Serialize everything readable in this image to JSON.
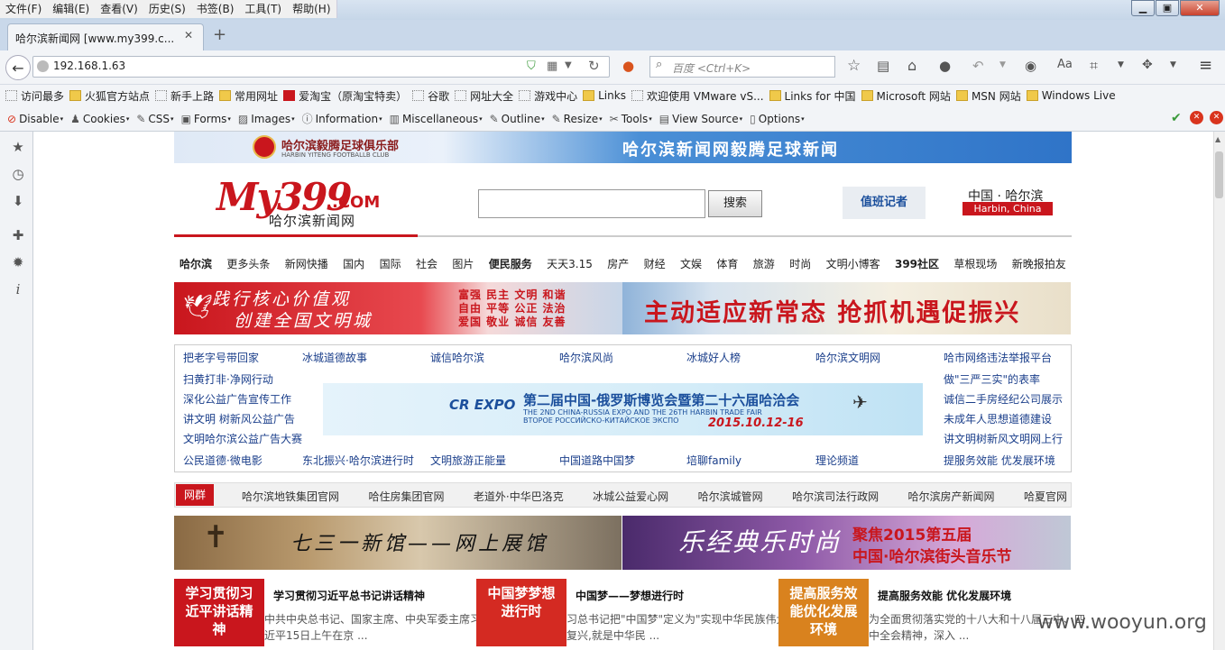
{
  "browser": {
    "menu": [
      "文件(F)",
      "编辑(E)",
      "查看(V)",
      "历史(S)",
      "书签(B)",
      "工具(T)",
      "帮助(H)"
    ],
    "tab_title": "哈尔滨新闻网 [www.my399.c...",
    "url": "192.168.1.63",
    "search_placeholder": "百度 <Ctrl+K>",
    "bookmarks": [
      "访问最多",
      "火狐官方站点",
      "新手上路",
      "常用网址",
      "爱淘宝（原淘宝特卖）",
      "谷歌",
      "网址大全",
      "游戏中心",
      "Links",
      "欢迎使用 VMware vS...",
      "Links for 中国",
      "Microsoft 网站",
      "MSN 网站",
      "Windows Live"
    ],
    "devbar": [
      "Disable",
      "Cookies",
      "CSS",
      "Forms",
      "Images",
      "Information",
      "Miscellaneous",
      "Outline",
      "Resize",
      "Tools",
      "View Source",
      "Options"
    ]
  },
  "page": {
    "banner_left": "哈尔滨毅腾足球俱乐部",
    "banner_left_en": "HARBIN YITENG FOOTBALLB CLUB",
    "banner_right": "哈尔滨新闻网毅腾足球新闻",
    "logo": "My399",
    "logo_com": ".COM",
    "logo_sub": "哈尔滨新闻网",
    "search_button": "搜索",
    "reporter": "值班记者",
    "location_cn": "中国 · 哈尔滨",
    "location_en": "Harbin, China",
    "nav": [
      {
        "t": "哈尔滨",
        "b": true
      },
      {
        "t": "更多头条",
        "b": false
      },
      {
        "t": "新网快播",
        "b": false
      },
      {
        "t": "国内",
        "b": false
      },
      {
        "t": "国际",
        "b": false
      },
      {
        "t": "社会",
        "b": false
      },
      {
        "t": "图片",
        "b": false
      },
      {
        "t": "便民服务",
        "b": true
      },
      {
        "t": "天天3.15",
        "b": false
      },
      {
        "t": "房产",
        "b": false
      },
      {
        "t": "财经",
        "b": false
      },
      {
        "t": "文娱",
        "b": false
      },
      {
        "t": "体育",
        "b": false
      },
      {
        "t": "旅游",
        "b": false
      },
      {
        "t": "时尚",
        "b": false
      },
      {
        "t": "文明小博客",
        "b": false
      },
      {
        "t": "399社区",
        "b": true
      },
      {
        "t": "草根现场",
        "b": false
      },
      {
        "t": "新晚报拍友",
        "b": false
      }
    ],
    "promo_left_1": "践行核心价值观",
    "promo_left_2": "创建全国文明城",
    "values": [
      "富强 民主 文明 和谐",
      "自由 平等 公正 法治",
      "爱国 敬业 诚信 友善"
    ],
    "promo_right": "主动适应新常态 抢抓机遇促振兴",
    "links": {
      "row1": [
        "把老字号带回家",
        "冰城道德故事",
        "诚信哈尔滨",
        "哈尔滨风尚",
        "冰城好人榜",
        "哈尔滨文明网",
        "哈市网络违法举报平台"
      ],
      "left": [
        "扫黄打非·净网行动",
        "深化公益广告宣传工作",
        "讲文明 树新风公益广告",
        "文明哈尔滨公益广告大赛"
      ],
      "right": [
        "做\"三严三实\"的表率",
        "诚信二手房经纪公司展示",
        "未成年人思想道德建设",
        "讲文明树新风文明网上行"
      ],
      "bottom": [
        "公民道德·微电影",
        "东北振兴·哈尔滨进行时",
        "文明旅游正能量",
        "中国道路中国梦",
        "培聊family",
        "理论频道",
        "提服务效能 优发展环境"
      ]
    },
    "expo_title": "第二届中国-俄罗斯博览会暨第二十六届哈洽会",
    "expo_en": "THE 2ND CHINA-RUSSIA EXPO AND THE 26TH HARBIN TRADE FAIR",
    "expo_ru": "ВТОРОЕ РОССИЙСКО-КИТАЙСКОЕ ЭКСПО",
    "expo_date": "2015.10.12-16",
    "expo_logo": "CR EXPO",
    "group_tag": "网群",
    "group_links": [
      "哈尔滨地铁集团官网",
      "哈住房集团官网",
      "老道外·中华巴洛克",
      "冰城公益爱心网",
      "哈尔滨城管网",
      "哈尔滨司法行政网",
      "哈尔滨房产新闻网",
      "哈夏官网"
    ],
    "pic1_text": "七三一新馆——网上展馆",
    "pic2_text": "乐经典乐时尚",
    "pic2_title_1": "聚焦2015第五届",
    "pic2_title_2": "中国·哈尔滨街头音乐节",
    "news": [
      {
        "thumb": "学习贯彻习近平讲话精神",
        "title": "学习贯彻习近平总书记讲话精神",
        "body": "中共中央总书记、国家主席、中央军委主席习近平15日上午在京 ..."
      },
      {
        "thumb": "中国梦梦想进行时",
        "title": "中国梦——梦想进行时",
        "body": "习总书记把\"中国梦\"定义为\"实现中华民族伟大复兴,就是中华民 ..."
      },
      {
        "thumb": "提高服务效能优化发展环境",
        "title": "提高服务效能 优化发展环境",
        "body": "为全面贯彻落实党的十八大和十八届三中、四中全会精神，深入 ..."
      }
    ],
    "watermark": "www.wooyun.org"
  }
}
